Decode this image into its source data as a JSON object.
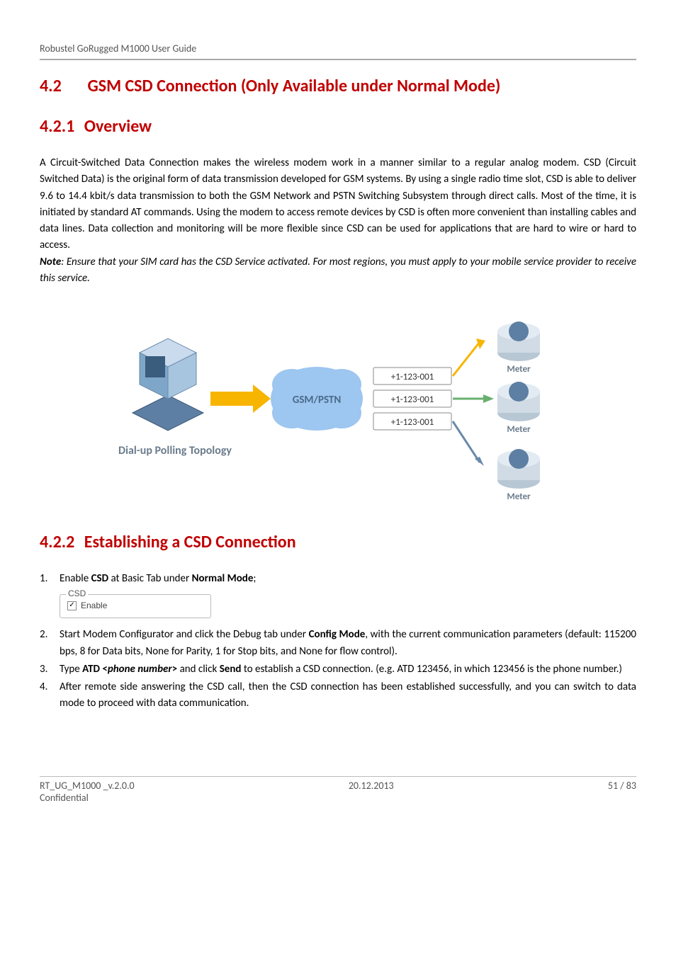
{
  "header": {
    "text": "Robustel GoRugged M1000 User Guide"
  },
  "section": {
    "num": "4.2",
    "title": "GSM CSD Connection (Only Available under Normal Mode)"
  },
  "subsection1": {
    "num": "4.2.1",
    "title": "Overview",
    "paragraph": "A Circuit-Switched Data Connection makes the wireless modem work in a manner similar to a regular analog modem. CSD (Circuit Switched Data) is the original form of data transmission developed for GSM systems. By using a single radio time slot, CSD is able to deliver 9.6 to 14.4 kbit/s data transmission to both the GSM Network and PSTN Switching Subsystem through direct calls. Most of the time, it is initiated by standard AT commands. Using the modem to access remote devices by CSD is often more convenient than installing cables and data lines. Data collection and monitoring will be more flexible since CSD can be used for applications that are hard to wire or hard to access.",
    "note_label": "Note",
    "note_body": ": Ensure that your SIM card has the CSD Service activated. For most regions, you must apply to your mobile service provider to receive this service."
  },
  "diagram": {
    "caption": "Dial-up Polling Topology",
    "cloud_label": "GSM/PSTN",
    "phone_labels": [
      "+1-123-001",
      "+1-123-001",
      "+1-123-001"
    ],
    "meter_label": "Meter"
  },
  "subsection2": {
    "num": "4.2.2",
    "title": "Establishing a CSD Connection",
    "step1_pre": "Enable ",
    "step1_b1": "CSD",
    "step1_mid": " at Basic Tab under ",
    "step1_b2": "Normal Mode",
    "step1_post": ";",
    "csd_panel_title": "CSD",
    "csd_enable": "Enable",
    "step2_pre": "Start Modem Configurator and click the Debug tab under ",
    "step2_b1": "Config Mode",
    "step2_post": ", with the current communication parameters (default: 115200 bps, 8 for Data bits, None for Parity, 1 for Stop bits, and None for flow control).",
    "step3_pre": "Type ",
    "step3_b1": "ATD <",
    "step3_bi": "phone number",
    "step3_b2": ">",
    "step3_mid": " and click ",
    "step3_b3": "Send",
    "step3_post": " to establish a CSD connection. (e.g. ATD 123456, in which 123456 is the phone number.)",
    "step4": "After remote side answering the CSD call, then the CSD connection has been established successfully, and you can switch to data mode to proceed with data communication."
  },
  "footer": {
    "left1": "RT_UG_M1000 _v.2.0.0",
    "left2": "Confidential",
    "center": "20.12.2013",
    "right": "51 / 83"
  }
}
